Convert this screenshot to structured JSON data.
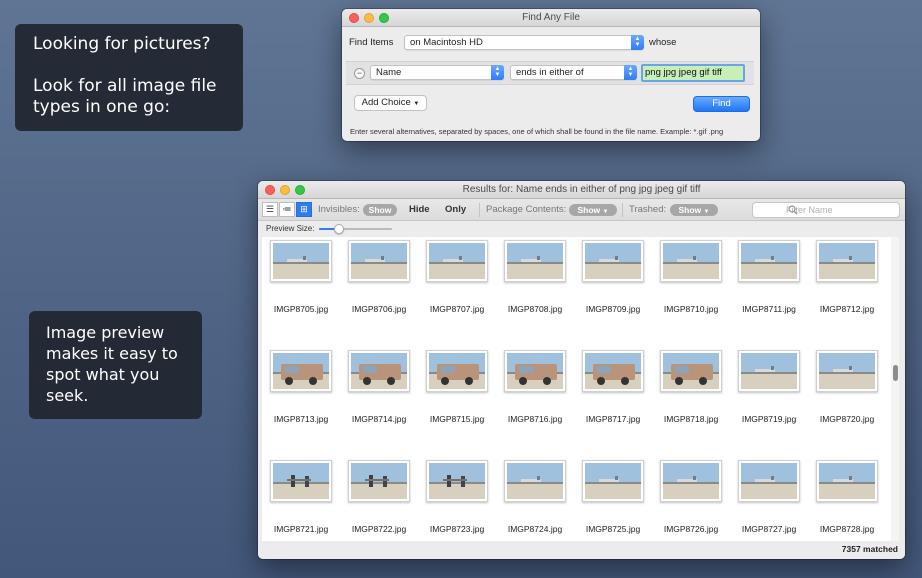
{
  "callouts": {
    "top": {
      "line1": "Looking for pictures?",
      "line2": "Look for all image file types in one go:"
    },
    "bottom": {
      "text": "Image preview makes it easy to spot what you seek."
    }
  },
  "find_window": {
    "title": "Find Any File",
    "find_items_label": "Find Items",
    "location": "on Macintosh HD",
    "whose_label": "whose",
    "attribute": "Name",
    "operator": "ends in either of",
    "value": "png jpg jpeg gif tiff",
    "add_choice_label": "Add Choice",
    "find_button_label": "Find",
    "hint": "Enter several alternatives, separated by spaces, one of which shall be found in the file name. Example: *.gif .png"
  },
  "results_window": {
    "title": "Results for: Name ends in either of png jpg jpeg gif tiff",
    "invisibles_label": "Invisibles:",
    "show_label": "Show",
    "hide_label": "Hide",
    "only_label": "Only",
    "package_contents_label": "Package Contents:",
    "trashed_label": "Trashed:",
    "filter_placeholder": "Filter Name",
    "preview_size_label": "Preview Size:",
    "preview_size_fraction": 0.28,
    "matched_count": "7357 matched",
    "files": [
      "IMGP8705.jpg",
      "IMGP8706.jpg",
      "IMGP8707.jpg",
      "IMGP8708.jpg",
      "IMGP8709.jpg",
      "IMGP8710.jpg",
      "IMGP8711.jpg",
      "IMGP8712.jpg",
      "IMGP8713.jpg",
      "IMGP8714.jpg",
      "IMGP8715.jpg",
      "IMGP8716.jpg",
      "IMGP8717.jpg",
      "IMGP8718.jpg",
      "IMGP8719.jpg",
      "IMGP8720.jpg",
      "IMGP8721.jpg",
      "IMGP8722.jpg",
      "IMGP8723.jpg",
      "IMGP8724.jpg",
      "IMGP8725.jpg",
      "IMGP8726.jpg",
      "IMGP8727.jpg",
      "IMGP8728.jpg"
    ]
  },
  "icons": {
    "list_view": "list-view-icon",
    "outline_view": "outline-view-icon",
    "grid_view": "grid-view-icon",
    "search": "search-icon"
  },
  "colors": {
    "accent": "#2f7cf6",
    "field_highlight": "#c6f0b8",
    "desktop": "#4f6485"
  }
}
